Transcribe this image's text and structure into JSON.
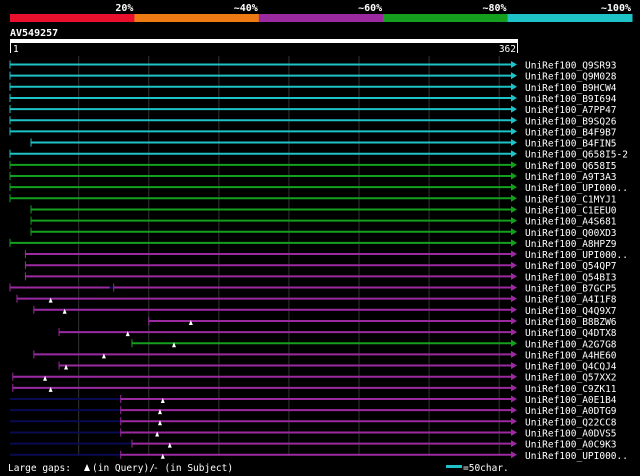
{
  "legend": {
    "ticks": [
      "20%",
      "~40%",
      "~60%",
      "~80%",
      "~100%"
    ],
    "colors": [
      "#e8102d",
      "#ee7a14",
      "#9b2aa0",
      "#14a01e",
      "#1ec3c8"
    ]
  },
  "query": {
    "id": "AV549257",
    "start": "1",
    "end": "362",
    "length": 362
  },
  "colors": {
    "cyan": "#1ec3c8",
    "green": "#14a01e",
    "magenta": "#9b2aa0",
    "gap": "#0a0a50",
    "grid": "#333333",
    "marker": "#ffffff"
  },
  "hits": [
    {
      "label": "UniRef100_Q9SR93",
      "color": "cyan",
      "segments": [
        [
          1,
          362
        ]
      ]
    },
    {
      "label": "UniRef100_Q9M028",
      "color": "cyan",
      "segments": [
        [
          1,
          362
        ]
      ]
    },
    {
      "label": "UniRef100_B9HCW4",
      "color": "cyan",
      "segments": [
        [
          1,
          362
        ]
      ]
    },
    {
      "label": "UniRef100_B9I694",
      "color": "cyan",
      "segments": [
        [
          1,
          362
        ]
      ]
    },
    {
      "label": "UniRef100_A7PP47",
      "color": "cyan",
      "segments": [
        [
          1,
          362
        ]
      ]
    },
    {
      "label": "UniRef100_B9SQ26",
      "color": "cyan",
      "segments": [
        [
          1,
          362
        ]
      ]
    },
    {
      "label": "UniRef100_B4F9B7",
      "color": "cyan",
      "segments": [
        [
          1,
          362
        ]
      ]
    },
    {
      "label": "UniRef100_B4FIN5",
      "color": "cyan",
      "segments": [
        [
          16,
          362
        ]
      ]
    },
    {
      "label": "UniRef100_Q658I5-2",
      "color": "cyan",
      "segments": [
        [
          1,
          362
        ]
      ]
    },
    {
      "label": "UniRef100_Q658I5",
      "color": "green",
      "segments": [
        [
          1,
          362
        ]
      ]
    },
    {
      "label": "UniRef100_A9T3A3",
      "color": "green",
      "segments": [
        [
          1,
          362
        ]
      ]
    },
    {
      "label": "UniRef100_UPI000..",
      "color": "green",
      "segments": [
        [
          1,
          362
        ]
      ]
    },
    {
      "label": "UniRef100_C1MYJ1",
      "color": "green",
      "segments": [
        [
          1,
          362
        ]
      ]
    },
    {
      "label": "UniRef100_C1EEU0",
      "color": "green",
      "segments": [
        [
          16,
          362
        ]
      ]
    },
    {
      "label": "UniRef100_A4S681",
      "color": "green",
      "segments": [
        [
          16,
          362
        ]
      ]
    },
    {
      "label": "UniRef100_Q00XD3",
      "color": "green",
      "segments": [
        [
          16,
          362
        ]
      ]
    },
    {
      "label": "UniRef100_A8HPZ9",
      "color": "green",
      "segments": [
        [
          1,
          362
        ]
      ]
    },
    {
      "label": "UniRef100_UPI000..",
      "color": "magenta",
      "segments": [
        [
          12,
          362
        ]
      ]
    },
    {
      "label": "UniRef100_Q54QP7",
      "color": "magenta",
      "segments": [
        [
          12,
          362
        ]
      ]
    },
    {
      "label": "UniRef100_Q54BI3",
      "color": "magenta",
      "segments": [
        [
          12,
          362
        ]
      ]
    },
    {
      "label": "UniRef100_B7GCP5",
      "color": "magenta",
      "segments": [
        [
          1,
          75
        ],
        [
          75,
          362
        ]
      ],
      "gap": [
        1,
        75
      ],
      "markers": []
    },
    {
      "label": "UniRef100_A4I1F8",
      "color": "magenta",
      "segments": [
        [
          6,
          362
        ]
      ],
      "gap": [
        6,
        60
      ],
      "markers": [
        30
      ]
    },
    {
      "label": "UniRef100_Q4Q9X7",
      "color": "magenta",
      "segments": [
        [
          18,
          362
        ]
      ],
      "gap": [
        18,
        80
      ],
      "markers": [
        40
      ]
    },
    {
      "label": "UniRef100_B8BZW6",
      "color": "magenta",
      "segments": [
        [
          100,
          362
        ]
      ],
      "markers": [
        130
      ]
    },
    {
      "label": "UniRef100_Q4DTX8",
      "color": "magenta",
      "segments": [
        [
          36,
          362
        ]
      ],
      "gap": [
        36,
        80
      ],
      "markers": [
        85
      ]
    },
    {
      "label": "UniRef100_A2G7G8",
      "color": "green",
      "segments": [
        [
          88,
          362
        ]
      ],
      "markers": [
        118
      ]
    },
    {
      "label": "UniRef100_A4HE60",
      "color": "magenta",
      "segments": [
        [
          18,
          362
        ]
      ],
      "gap": [
        18,
        65
      ],
      "markers": [
        68
      ]
    },
    {
      "label": "UniRef100_Q4CQJ4",
      "color": "magenta",
      "segments": [
        [
          36,
          362
        ]
      ],
      "gap": [
        36,
        85
      ],
      "markers": [
        41
      ]
    },
    {
      "label": "UniRef100_Q57XX2",
      "color": "magenta",
      "segments": [
        [
          3,
          362
        ]
      ],
      "gap": [
        3,
        60
      ],
      "markers": [
        26
      ]
    },
    {
      "label": "UniRef100_C9ZK11",
      "color": "magenta",
      "segments": [
        [
          3,
          362
        ]
      ],
      "gap": [
        3,
        60
      ],
      "markers": [
        30
      ]
    },
    {
      "label": "UniRef100_A0E1B4",
      "color": "magenta",
      "segments": [
        [
          80,
          362
        ]
      ],
      "gap": [
        1,
        80
      ],
      "markers": [
        110
      ]
    },
    {
      "label": "UniRef100_A0DTG9",
      "color": "magenta",
      "segments": [
        [
          80,
          362
        ]
      ],
      "gap": [
        1,
        80
      ],
      "markers": [
        108
      ]
    },
    {
      "label": "UniRef100_Q22CC8",
      "color": "magenta",
      "segments": [
        [
          80,
          362
        ]
      ],
      "gap": [
        1,
        80
      ],
      "markers": [
        108
      ]
    },
    {
      "label": "UniRef100_A0DVS5",
      "color": "magenta",
      "segments": [
        [
          80,
          362
        ]
      ],
      "gap": [
        1,
        80
      ],
      "markers": [
        106
      ]
    },
    {
      "label": "UniRef100_A0C9K3",
      "color": "magenta",
      "segments": [
        [
          88,
          362
        ]
      ],
      "gap": [
        1,
        88
      ],
      "markers": [
        115
      ]
    },
    {
      "label": "UniRef100_UPI000..",
      "color": "magenta",
      "segments": [
        [
          80,
          362
        ]
      ],
      "gap": [
        1,
        80
      ],
      "markers": [
        110
      ]
    }
  ],
  "footer": {
    "large_gaps": "Large gaps:",
    "in_query": "(in Query)/",
    "in_subject": "- (in Subject)",
    "scale": "=50char."
  }
}
